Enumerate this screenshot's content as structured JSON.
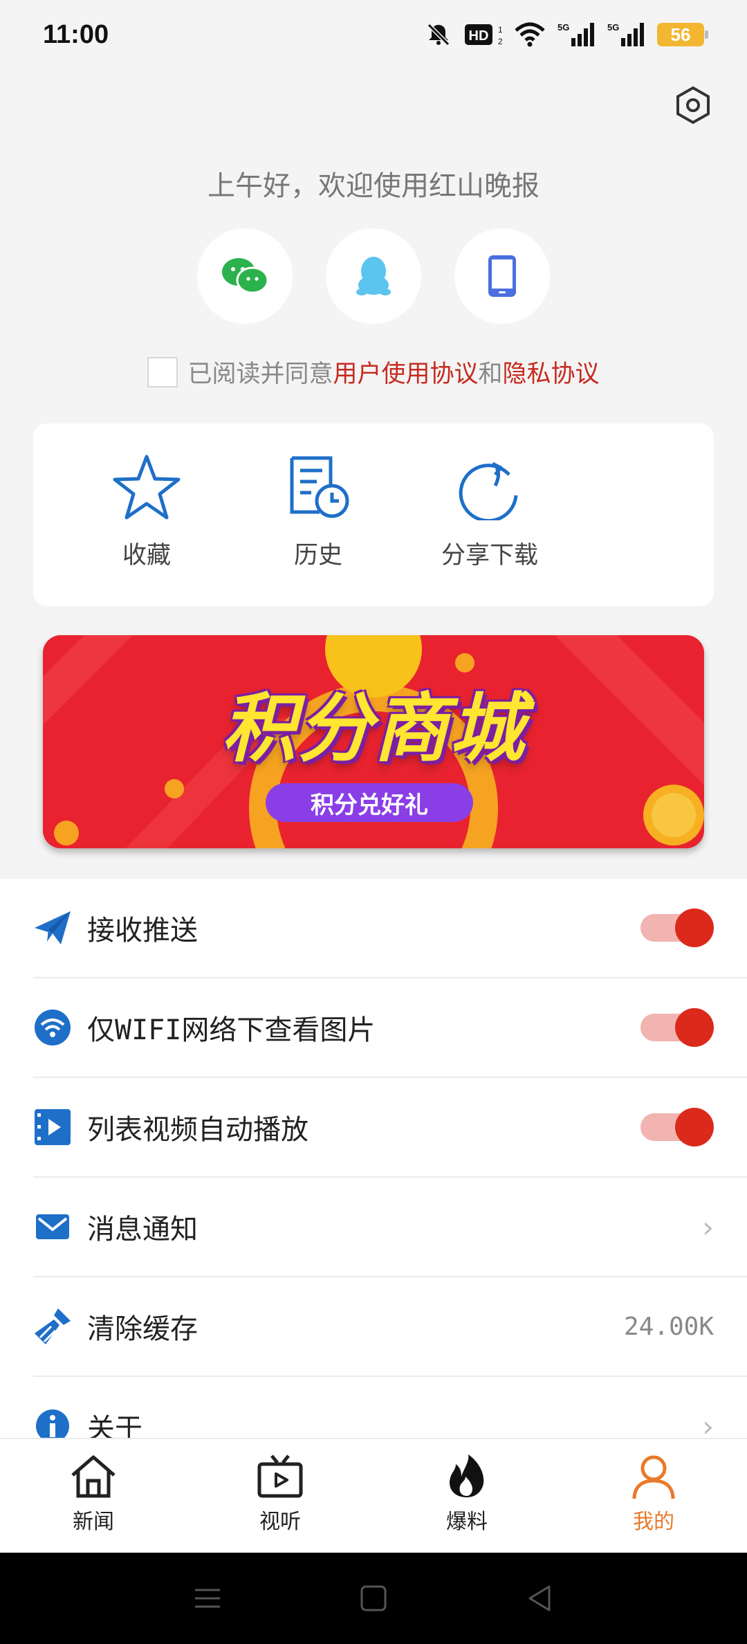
{
  "status": {
    "time": "11:00",
    "battery": "56",
    "network": "5G"
  },
  "header": {
    "greeting": "上午好，欢迎使用红山晚报"
  },
  "agreement": {
    "prefix": "已阅读并同意",
    "user_agreement": "用户使用协议",
    "and": "和",
    "privacy": "隐私协议"
  },
  "quick": [
    {
      "label": "收藏",
      "icon": "star-icon"
    },
    {
      "label": "历史",
      "icon": "history-icon"
    },
    {
      "label": "分享下载",
      "icon": "share-icon"
    }
  ],
  "banner": {
    "title": "积分商城",
    "subtitle": "积分兑好礼"
  },
  "settings": [
    {
      "label": "接收推送",
      "toggle": true
    },
    {
      "label": "仅WIFI网络下查看图片",
      "toggle": true
    },
    {
      "label": "列表视频自动播放",
      "toggle": true
    },
    {
      "label": "消息通知"
    },
    {
      "label": "清除缓存",
      "value": "24.00K"
    },
    {
      "label": "关于"
    }
  ],
  "tabs": [
    {
      "label": "新闻",
      "icon": "home-icon"
    },
    {
      "label": "视听",
      "icon": "tv-icon"
    },
    {
      "label": "爆料",
      "icon": "flame-icon"
    },
    {
      "label": "我的",
      "icon": "user-icon",
      "active": true
    }
  ],
  "colors": {
    "accent_red": "#db2a1c",
    "link_red": "#c62a1f",
    "icon_blue": "#1e6fc8",
    "tab_active": "#e87a2a"
  }
}
